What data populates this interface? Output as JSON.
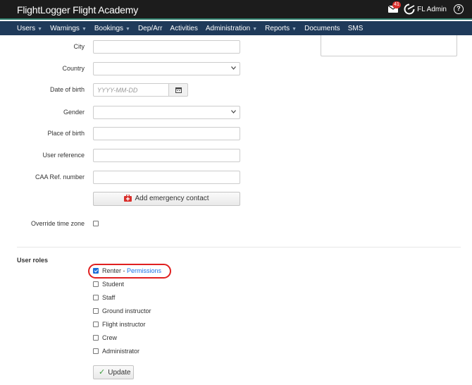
{
  "header": {
    "brand": "FlightLogger Flight Academy",
    "mail_count": "41",
    "user_name": "FL Admin",
    "help_icon": "?"
  },
  "nav": [
    {
      "label": "Users",
      "dropdown": true
    },
    {
      "label": "Warnings",
      "dropdown": true
    },
    {
      "label": "Bookings",
      "dropdown": true
    },
    {
      "label": "Dep/Arr",
      "dropdown": false
    },
    {
      "label": "Activities",
      "dropdown": false
    },
    {
      "label": "Administration",
      "dropdown": true
    },
    {
      "label": "Reports",
      "dropdown": true
    },
    {
      "label": "Documents",
      "dropdown": false
    },
    {
      "label": "SMS",
      "dropdown": false
    }
  ],
  "form": {
    "city_label": "City",
    "country_label": "Country",
    "dob_label": "Date of birth",
    "dob_placeholder": "YYYY-MM-DD",
    "gender_label": "Gender",
    "place_of_birth_label": "Place of birth",
    "user_reference_label": "User reference",
    "caa_label": "CAA Ref. number",
    "emergency_button": "Add emergency contact",
    "override_tz_label": "Override time zone"
  },
  "roles": {
    "title": "User roles",
    "items": [
      {
        "label": "Renter",
        "checked": true,
        "separator": " - ",
        "link": "Permissions"
      },
      {
        "label": "Student",
        "checked": false
      },
      {
        "label": "Staff",
        "checked": false
      },
      {
        "label": "Ground instructor",
        "checked": false
      },
      {
        "label": "Flight instructor",
        "checked": false
      },
      {
        "label": "Crew",
        "checked": false
      },
      {
        "label": "Administrator",
        "checked": false
      }
    ],
    "update_button": "Update"
  },
  "colors": {
    "topbar": "#1c1c1c",
    "navbar": "#1f3a5a",
    "link": "#1a73e8",
    "highlight": "#e02020",
    "checkbox_checked": "#1e6fd9"
  }
}
